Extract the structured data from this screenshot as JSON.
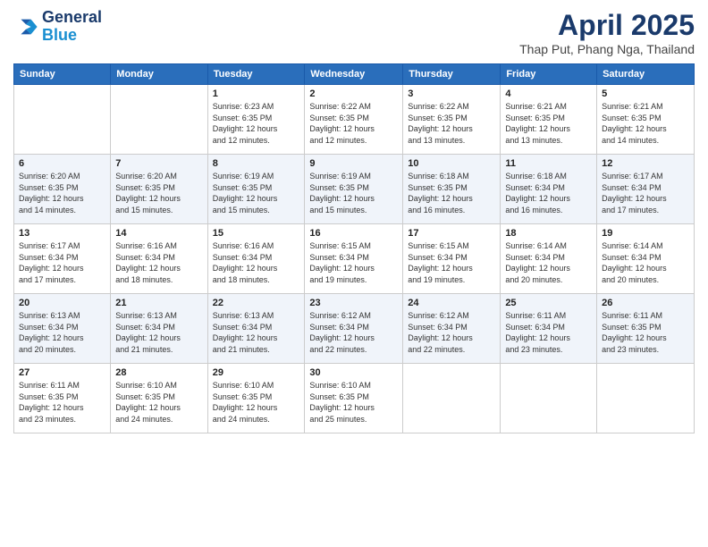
{
  "logo": {
    "text_general": "General",
    "text_blue": "Blue"
  },
  "header": {
    "title": "April 2025",
    "subtitle": "Thap Put, Phang Nga, Thailand"
  },
  "days_of_week": [
    "Sunday",
    "Monday",
    "Tuesday",
    "Wednesday",
    "Thursday",
    "Friday",
    "Saturday"
  ],
  "weeks": [
    {
      "days": [
        {
          "num": "",
          "info": ""
        },
        {
          "num": "",
          "info": ""
        },
        {
          "num": "1",
          "info": "Sunrise: 6:23 AM\nSunset: 6:35 PM\nDaylight: 12 hours\nand 12 minutes."
        },
        {
          "num": "2",
          "info": "Sunrise: 6:22 AM\nSunset: 6:35 PM\nDaylight: 12 hours\nand 12 minutes."
        },
        {
          "num": "3",
          "info": "Sunrise: 6:22 AM\nSunset: 6:35 PM\nDaylight: 12 hours\nand 13 minutes."
        },
        {
          "num": "4",
          "info": "Sunrise: 6:21 AM\nSunset: 6:35 PM\nDaylight: 12 hours\nand 13 minutes."
        },
        {
          "num": "5",
          "info": "Sunrise: 6:21 AM\nSunset: 6:35 PM\nDaylight: 12 hours\nand 14 minutes."
        }
      ]
    },
    {
      "days": [
        {
          "num": "6",
          "info": "Sunrise: 6:20 AM\nSunset: 6:35 PM\nDaylight: 12 hours\nand 14 minutes."
        },
        {
          "num": "7",
          "info": "Sunrise: 6:20 AM\nSunset: 6:35 PM\nDaylight: 12 hours\nand 15 minutes."
        },
        {
          "num": "8",
          "info": "Sunrise: 6:19 AM\nSunset: 6:35 PM\nDaylight: 12 hours\nand 15 minutes."
        },
        {
          "num": "9",
          "info": "Sunrise: 6:19 AM\nSunset: 6:35 PM\nDaylight: 12 hours\nand 15 minutes."
        },
        {
          "num": "10",
          "info": "Sunrise: 6:18 AM\nSunset: 6:35 PM\nDaylight: 12 hours\nand 16 minutes."
        },
        {
          "num": "11",
          "info": "Sunrise: 6:18 AM\nSunset: 6:34 PM\nDaylight: 12 hours\nand 16 minutes."
        },
        {
          "num": "12",
          "info": "Sunrise: 6:17 AM\nSunset: 6:34 PM\nDaylight: 12 hours\nand 17 minutes."
        }
      ]
    },
    {
      "days": [
        {
          "num": "13",
          "info": "Sunrise: 6:17 AM\nSunset: 6:34 PM\nDaylight: 12 hours\nand 17 minutes."
        },
        {
          "num": "14",
          "info": "Sunrise: 6:16 AM\nSunset: 6:34 PM\nDaylight: 12 hours\nand 18 minutes."
        },
        {
          "num": "15",
          "info": "Sunrise: 6:16 AM\nSunset: 6:34 PM\nDaylight: 12 hours\nand 18 minutes."
        },
        {
          "num": "16",
          "info": "Sunrise: 6:15 AM\nSunset: 6:34 PM\nDaylight: 12 hours\nand 19 minutes."
        },
        {
          "num": "17",
          "info": "Sunrise: 6:15 AM\nSunset: 6:34 PM\nDaylight: 12 hours\nand 19 minutes."
        },
        {
          "num": "18",
          "info": "Sunrise: 6:14 AM\nSunset: 6:34 PM\nDaylight: 12 hours\nand 20 minutes."
        },
        {
          "num": "19",
          "info": "Sunrise: 6:14 AM\nSunset: 6:34 PM\nDaylight: 12 hours\nand 20 minutes."
        }
      ]
    },
    {
      "days": [
        {
          "num": "20",
          "info": "Sunrise: 6:13 AM\nSunset: 6:34 PM\nDaylight: 12 hours\nand 20 minutes."
        },
        {
          "num": "21",
          "info": "Sunrise: 6:13 AM\nSunset: 6:34 PM\nDaylight: 12 hours\nand 21 minutes."
        },
        {
          "num": "22",
          "info": "Sunrise: 6:13 AM\nSunset: 6:34 PM\nDaylight: 12 hours\nand 21 minutes."
        },
        {
          "num": "23",
          "info": "Sunrise: 6:12 AM\nSunset: 6:34 PM\nDaylight: 12 hours\nand 22 minutes."
        },
        {
          "num": "24",
          "info": "Sunrise: 6:12 AM\nSunset: 6:34 PM\nDaylight: 12 hours\nand 22 minutes."
        },
        {
          "num": "25",
          "info": "Sunrise: 6:11 AM\nSunset: 6:34 PM\nDaylight: 12 hours\nand 23 minutes."
        },
        {
          "num": "26",
          "info": "Sunrise: 6:11 AM\nSunset: 6:35 PM\nDaylight: 12 hours\nand 23 minutes."
        }
      ]
    },
    {
      "days": [
        {
          "num": "27",
          "info": "Sunrise: 6:11 AM\nSunset: 6:35 PM\nDaylight: 12 hours\nand 23 minutes."
        },
        {
          "num": "28",
          "info": "Sunrise: 6:10 AM\nSunset: 6:35 PM\nDaylight: 12 hours\nand 24 minutes."
        },
        {
          "num": "29",
          "info": "Sunrise: 6:10 AM\nSunset: 6:35 PM\nDaylight: 12 hours\nand 24 minutes."
        },
        {
          "num": "30",
          "info": "Sunrise: 6:10 AM\nSunset: 6:35 PM\nDaylight: 12 hours\nand 25 minutes."
        },
        {
          "num": "",
          "info": ""
        },
        {
          "num": "",
          "info": ""
        },
        {
          "num": "",
          "info": ""
        }
      ]
    }
  ]
}
